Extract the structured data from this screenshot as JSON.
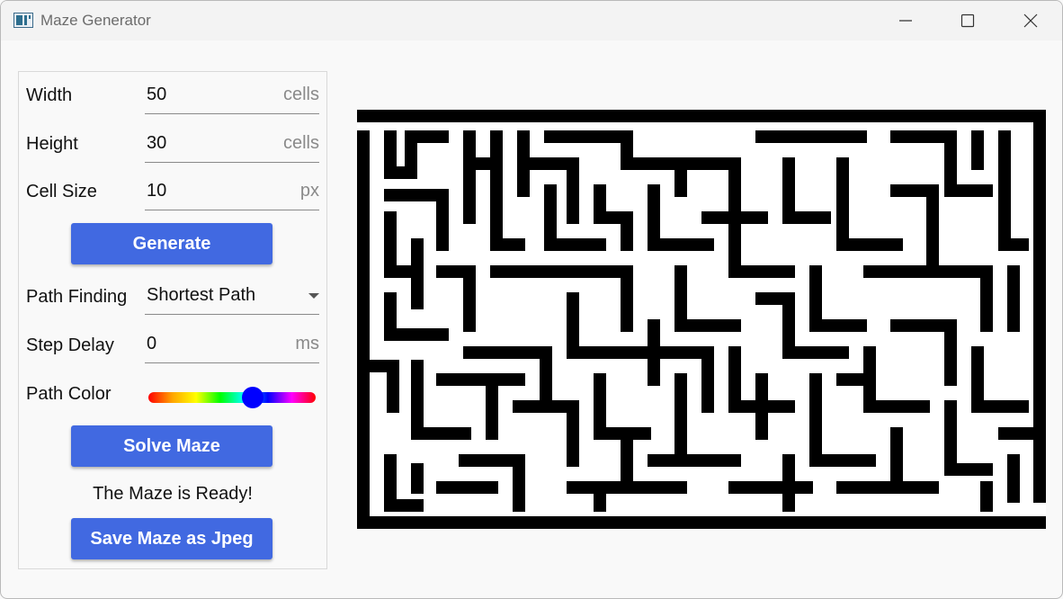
{
  "window": {
    "title": "Maze Generator"
  },
  "controls": {
    "width": {
      "label": "Width",
      "value": "50",
      "unit": "cells"
    },
    "height": {
      "label": "Height",
      "value": "30",
      "unit": "cells"
    },
    "cell_size": {
      "label": "Cell Size",
      "value": "10",
      "unit": "px"
    },
    "generate_label": "Generate",
    "path_finding": {
      "label": "Path Finding",
      "value": "Shortest Path"
    },
    "step_delay": {
      "label": "Step Delay",
      "value": "0",
      "unit": "ms"
    },
    "path_color": {
      "label": "Path Color",
      "hue_fraction": 0.64,
      "color": "#0000ff"
    },
    "solve_label": "Solve Maze",
    "status": "The Maze is Ready!",
    "save_label": "Save Maze as Jpeg"
  },
  "colors": {
    "accent": "#4169e1",
    "maze_wall": "#000000",
    "maze_floor": "#ffffff"
  }
}
